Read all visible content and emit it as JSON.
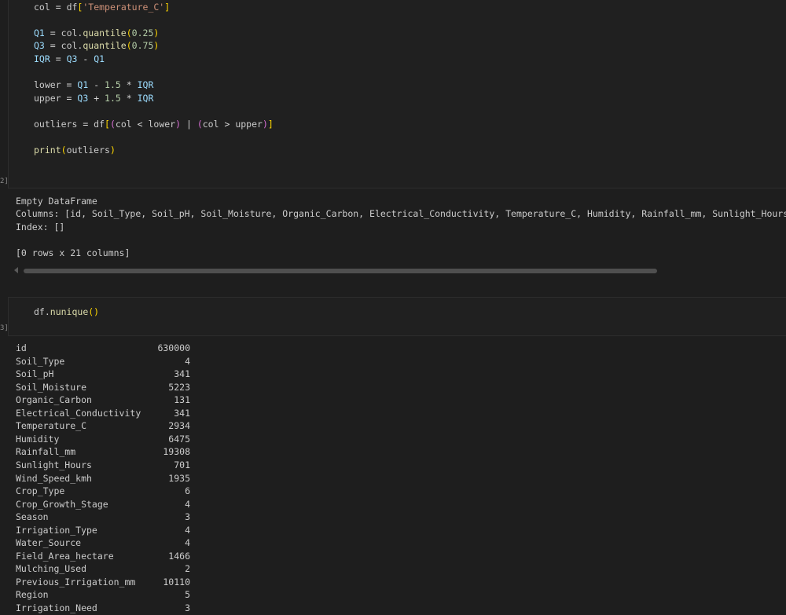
{
  "cell1": {
    "exec_count": "2]",
    "lines": [
      "col = df['Temperature_C']",
      "",
      "Q1 = col.quantile(0.25)",
      "Q3 = col.quantile(0.75)",
      "IQR = Q3 - Q1",
      "",
      "lower = Q1 - 1.5 * IQR",
      "upper = Q3 + 1.5 * IQR",
      "",
      "outliers = df[(col < lower) | (col > upper)]",
      "",
      "print(outliers)"
    ]
  },
  "output1": {
    "lines": [
      "Empty DataFrame",
      "Columns: [id, Soil_Type, Soil_pH, Soil_Moisture, Organic_Carbon, Electrical_Conductivity, Temperature_C, Humidity, Rainfall_mm, Sunlight_Hours, Wi",
      "Index: []",
      "",
      "[0 rows x 21 columns]"
    ]
  },
  "cell2": {
    "exec_count": "3]",
    "code": "df.nunique()"
  },
  "output2": {
    "rows": [
      {
        "name": "id",
        "value": "630000"
      },
      {
        "name": "Soil_Type",
        "value": "4"
      },
      {
        "name": "Soil_pH",
        "value": "341"
      },
      {
        "name": "Soil_Moisture",
        "value": "5223"
      },
      {
        "name": "Organic_Carbon",
        "value": "131"
      },
      {
        "name": "Electrical_Conductivity",
        "value": "341"
      },
      {
        "name": "Temperature_C",
        "value": "2934"
      },
      {
        "name": "Humidity",
        "value": "6475"
      },
      {
        "name": "Rainfall_mm",
        "value": "19308"
      },
      {
        "name": "Sunlight_Hours",
        "value": "701"
      },
      {
        "name": "Wind_Speed_kmh",
        "value": "1935"
      },
      {
        "name": "Crop_Type",
        "value": "6"
      },
      {
        "name": "Crop_Growth_Stage",
        "value": "4"
      },
      {
        "name": "Season",
        "value": "3"
      },
      {
        "name": "Irrigation_Type",
        "value": "4"
      },
      {
        "name": "Water_Source",
        "value": "4"
      },
      {
        "name": "Field_Area_hectare",
        "value": "1466"
      },
      {
        "name": "Mulching_Used",
        "value": "2"
      },
      {
        "name": "Previous_Irrigation_mm",
        "value": "10110"
      },
      {
        "name": "Region",
        "value": "5"
      },
      {
        "name": "Irrigation_Need",
        "value": "3"
      }
    ]
  }
}
